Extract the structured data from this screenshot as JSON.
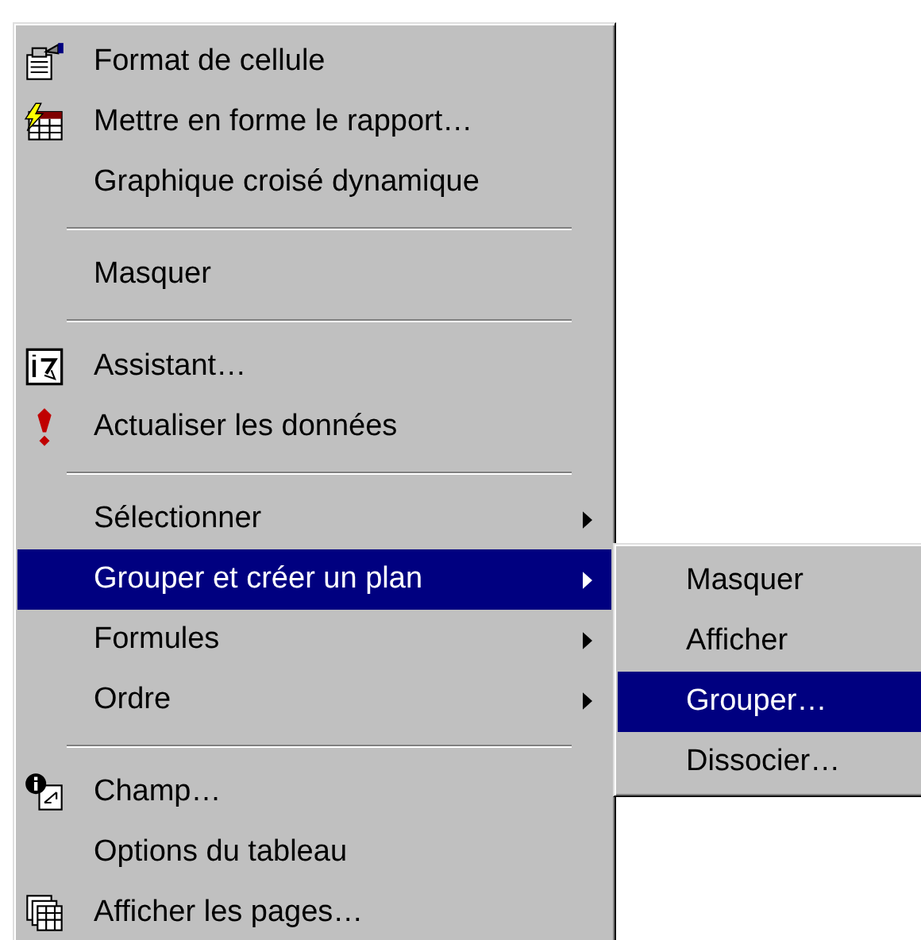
{
  "menu": {
    "items": [
      {
        "kind": "command",
        "label": "Format de cellule",
        "submenu": false,
        "selected": false
      },
      {
        "kind": "command",
        "label": "Mettre en forme le rapport…",
        "submenu": false,
        "selected": false
      },
      {
        "kind": "command",
        "label": "Graphique croisé dynamique",
        "submenu": false,
        "selected": false
      },
      {
        "kind": "separator"
      },
      {
        "kind": "command",
        "label": "Masquer",
        "submenu": false,
        "selected": false
      },
      {
        "kind": "separator"
      },
      {
        "kind": "command",
        "label": "Assistant…",
        "submenu": false,
        "selected": false
      },
      {
        "kind": "command",
        "label": "Actualiser les données",
        "submenu": false,
        "selected": false
      },
      {
        "kind": "separator"
      },
      {
        "kind": "command",
        "label": "Sélectionner",
        "submenu": true,
        "selected": false
      },
      {
        "kind": "command",
        "label": "Grouper et créer un plan",
        "submenu": true,
        "selected": true
      },
      {
        "kind": "command",
        "label": "Formules",
        "submenu": true,
        "selected": false
      },
      {
        "kind": "command",
        "label": "Ordre",
        "submenu": true,
        "selected": false
      },
      {
        "kind": "separator"
      },
      {
        "kind": "command",
        "label": "Champ…",
        "submenu": false,
        "selected": false
      },
      {
        "kind": "command",
        "label": "Options du tableau",
        "submenu": false,
        "selected": false
      },
      {
        "kind": "command",
        "label": "Afficher les pages…",
        "submenu": false,
        "selected": false
      }
    ]
  },
  "submenu": {
    "items": [
      {
        "label": "Masquer",
        "selected": false
      },
      {
        "label": "Afficher",
        "selected": false
      },
      {
        "label": "Grouper…",
        "selected": true
      },
      {
        "label": "Dissocier…",
        "selected": false
      }
    ]
  }
}
